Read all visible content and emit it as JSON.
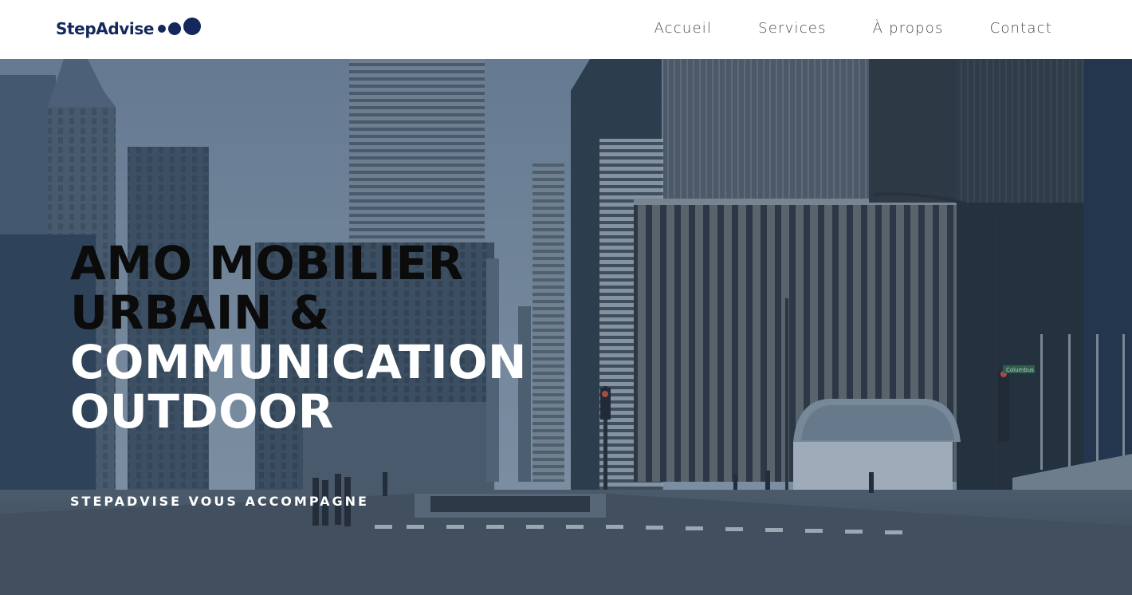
{
  "header": {
    "logo_text": "StepAdvise",
    "nav": [
      "Accueil",
      "Services",
      "À propos",
      "Contact"
    ]
  },
  "hero": {
    "headline": [
      "AMO MOBILIER",
      "URBAIN &",
      "COMMUNICATION",
      "OUTDOOR"
    ],
    "tagline": "STEPADVISE VOUS ACCOMPAGNE",
    "street_sign": "Columbus"
  },
  "colors": {
    "brand": "#14285c",
    "nav_text": "#4a4a4a",
    "headline_dark": "#0b0b0b",
    "headline_light": "#ffffff",
    "sky": "#8a9db0",
    "overlay": "#2e4663"
  }
}
